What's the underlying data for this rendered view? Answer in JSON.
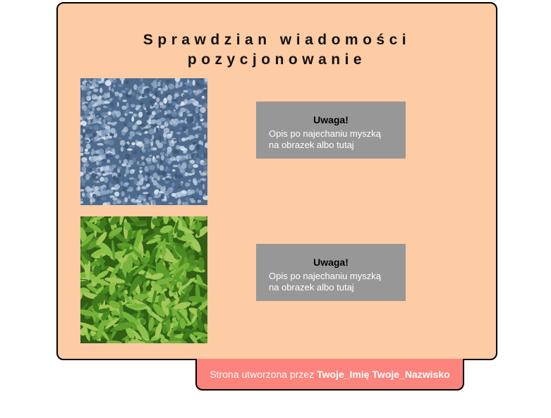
{
  "header": {
    "title_line1": "Sprawdzian wiadomości",
    "title_line2": "pozycjonowanie"
  },
  "tiles": [
    {
      "name": "carpet-texture-image",
      "color": "#6a86a8"
    },
    {
      "name": "grass-texture-image",
      "color": "#4d8a24"
    }
  ],
  "notes": [
    {
      "heading": "Uwaga!",
      "text_line1": "Opis po najechaniu myszką",
      "text_line2": "na obrazek albo tutaj"
    },
    {
      "heading": "Uwaga!",
      "text_line1": "Opis po najechaniu myszką",
      "text_line2": "na obrazek albo tutaj"
    }
  ],
  "footer": {
    "prefix": "Strona utworzona przez ",
    "author": "Twoje_Imię Twoje_Nazwisko"
  },
  "colors": {
    "panel": "#fdcba4",
    "note": "#979797",
    "footer": "#fd837d"
  }
}
